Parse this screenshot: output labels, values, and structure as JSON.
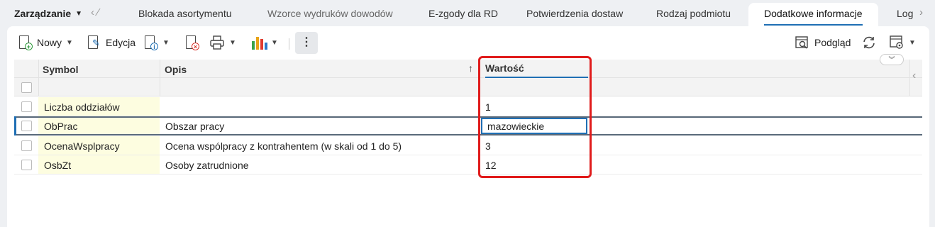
{
  "tabbar": {
    "menu_label": "Zarządzanie",
    "tabs": [
      {
        "label": "Blokada asortymentu"
      },
      {
        "label": "Wzorce wydruków dowodów"
      },
      {
        "label": "E-zgody dla RD"
      },
      {
        "label": "Potwierdzenia dostaw"
      },
      {
        "label": "Rodzaj podmiotu"
      },
      {
        "label": "Dodatkowe informacje"
      },
      {
        "label": "Log"
      }
    ]
  },
  "toolbar": {
    "new_label": "Nowy",
    "edit_label": "Edycja",
    "preview_label": "Podgląd"
  },
  "grid": {
    "columns": [
      "Symbol",
      "Opis",
      "Wartość"
    ],
    "rows": [
      {
        "symbol": "Liczba oddziałów",
        "opis": "",
        "wartosc": "1"
      },
      {
        "symbol": "ObPrac",
        "opis": "Obszar pracy",
        "wartosc": "mazowieckie"
      },
      {
        "symbol": "OcenaWsplpracy",
        "opis": "Ocena wspólpracy z kontrahentem (w skali od 1 do 5)",
        "wartosc": "3"
      },
      {
        "symbol": "OsbZt",
        "opis": "Osoby zatrudnione",
        "wartosc": "12"
      }
    ]
  },
  "colors": {
    "accent": "#1f6fb4",
    "highlight": "#e01b1b",
    "symbol_bg": "#fdfde0"
  }
}
